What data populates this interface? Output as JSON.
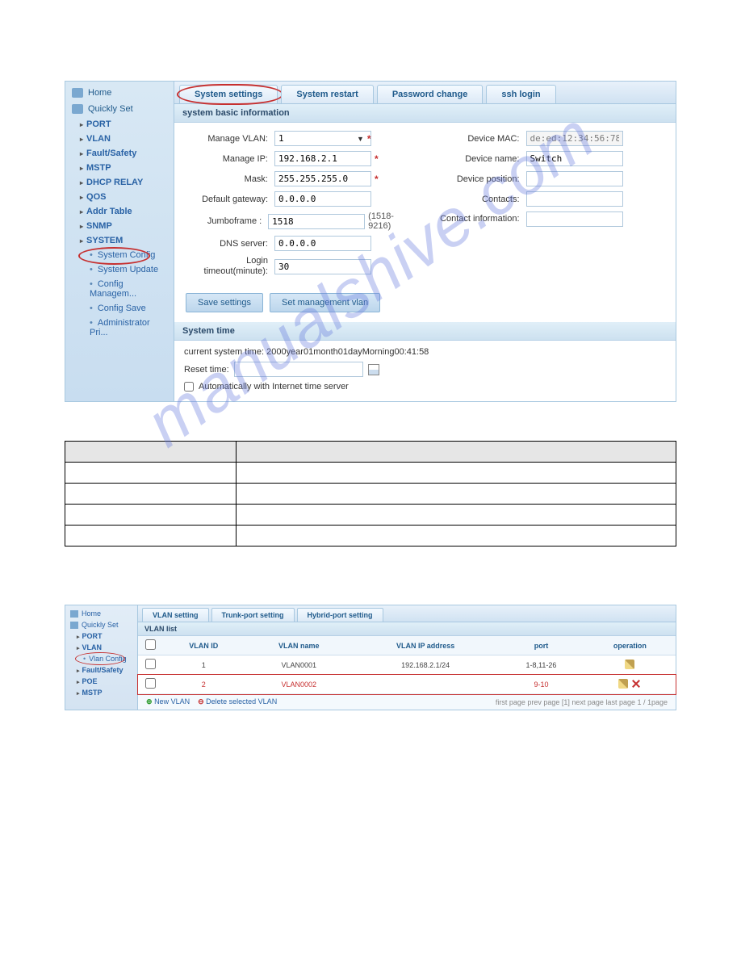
{
  "screenshot1": {
    "sidebar": {
      "home": "Home",
      "quickly": "Quickly Set",
      "items": [
        "PORT",
        "VLAN",
        "Fault/Safety",
        "MSTP",
        "DHCP RELAY",
        "QOS",
        "Addr Table",
        "SNMP",
        "SYSTEM"
      ],
      "subs": [
        "System Config",
        "System Update",
        "Config Managem...",
        "Config Save",
        "Administrator Pri..."
      ]
    },
    "tabs": [
      "System settings",
      "System restart",
      "Password change",
      "ssh login"
    ],
    "panel1_title": "system basic information",
    "form_left": [
      {
        "label": "Manage VLAN:",
        "value": "1",
        "req": true,
        "dropdown": true
      },
      {
        "label": "Manage IP:",
        "value": "192.168.2.1",
        "req": true
      },
      {
        "label": "Mask:",
        "value": "255.255.255.0",
        "req": true
      },
      {
        "label": "Default gateway:",
        "value": "0.0.0.0"
      },
      {
        "label": "Jumboframe :",
        "value": "1518",
        "hint": "(1518-9216)"
      },
      {
        "label": "DNS server:",
        "value": "0.0.0.0"
      },
      {
        "label": "Login timeout(minute):",
        "value": "30",
        "multiline": true
      }
    ],
    "form_right": [
      {
        "label": "Device MAC:",
        "value": "de:ed:12:34:56:78",
        "ro": true
      },
      {
        "label": "Device name:",
        "value": "Switch"
      },
      {
        "label": "Device position:",
        "value": ""
      },
      {
        "label": "Contacts:",
        "value": ""
      },
      {
        "label": "Contact information:",
        "value": "",
        "multiline": true
      }
    ],
    "btn_save": "Save settings",
    "btn_vlan": "Set management vlan",
    "panel2_title": "System time",
    "curtime_label": "current system time:",
    "curtime_value": "2000year01month01dayMorning00:41:58",
    "reset_label": "Reset time:",
    "auto_label": "Automatically with Internet time server"
  },
  "doc_table": {
    "headers": [
      "",
      ""
    ],
    "rows": [
      [
        "",
        ""
      ],
      [
        "",
        ""
      ],
      [
        "",
        ""
      ],
      [
        "",
        ""
      ]
    ]
  },
  "screenshot2": {
    "sidebar": {
      "home": "Home",
      "quickly": "Quickly Set",
      "items": [
        "PORT",
        "VLAN"
      ],
      "sub": "Vlan Config",
      "items2": [
        "Fault/Safety",
        "POE",
        "MSTP"
      ]
    },
    "tabs": [
      "VLAN setting",
      "Trunk-port setting",
      "Hybrid-port setting"
    ],
    "panel_title": "VLAN list",
    "columns": [
      "",
      "VLAN ID",
      "VLAN name",
      "VLAN IP address",
      "port",
      "operation"
    ],
    "rows": [
      {
        "check": false,
        "id": "1",
        "name": "VLAN0001",
        "ip": "192.168.2.1/24",
        "port": "1-8,11-26",
        "op": "edit"
      },
      {
        "check": false,
        "id": "2",
        "name": "VLAN0002",
        "ip": "",
        "port": "9-10",
        "op": "editdel",
        "hl": true
      }
    ],
    "footer": {
      "new": "New VLAN",
      "del": "Delete selected VLAN",
      "pager": "first page  prev page [1]  next page  last page 1    / 1page"
    }
  },
  "watermark": "manualshive.com"
}
